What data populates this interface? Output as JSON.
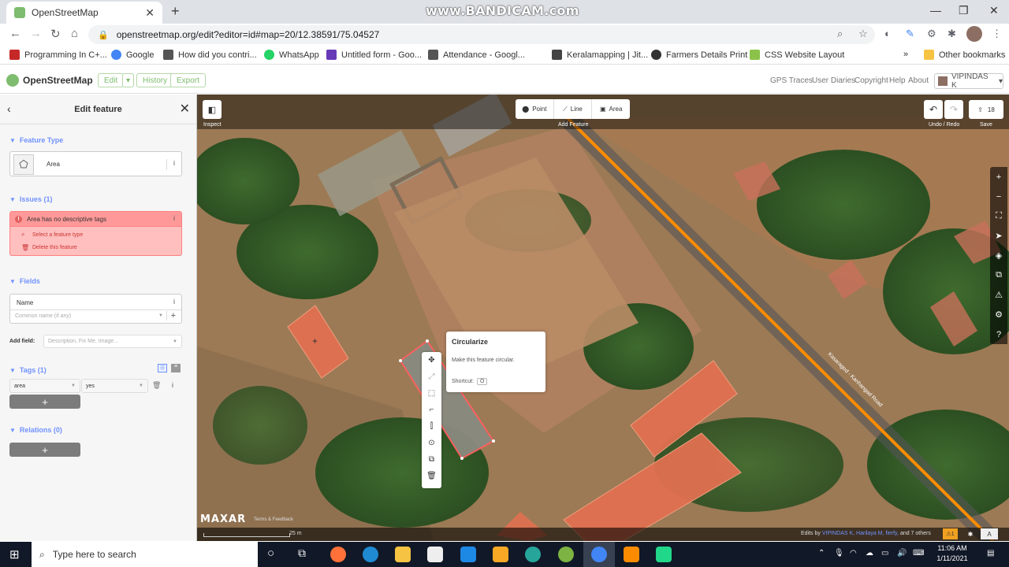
{
  "browser": {
    "tab_title": "OpenStreetMap",
    "watermark": "www.BANDICAM.com",
    "url": "openstreetmap.org/edit?editor=id#map=20/12.38591/75.04527",
    "bookmarks": [
      "Programming In C+...",
      "Google",
      "How did you contri...",
      "WhatsApp",
      "Untitled form - Goo...",
      "Attendance - Googl...",
      "Keralamapping | Jit...",
      "Farmers Details Print",
      "CSS Website Layout"
    ],
    "other_bookmarks": "Other bookmarks"
  },
  "osm": {
    "logo": "OpenStreetMap",
    "edit": "Edit",
    "history": "History",
    "export": "Export",
    "nav": [
      "GPS Traces",
      "User Diaries",
      "Copyright",
      "Help",
      "About"
    ],
    "user": "VIPINDAS K"
  },
  "sidebar": {
    "title": "Edit feature",
    "feature_type_label": "Feature Type",
    "feature_type": "Area",
    "issues_label": "Issues (1)",
    "issue": "Area has no descriptive tags",
    "issue_action_1": "Select a feature type",
    "issue_action_2": "Delete this feature",
    "fields_label": "Fields",
    "name_label": "Name",
    "name_placeholder": "Common name (if any)",
    "add_field_label": "Add field:",
    "add_field_placeholder": "Description, Fix Me, Image...",
    "tags_label": "Tags (1)",
    "tag_key": "area",
    "tag_value": "yes",
    "relations_label": "Relations (0)"
  },
  "map": {
    "inspect": "Inspect",
    "modes": [
      "Point",
      "Line",
      "Area"
    ],
    "add_feature": "Add Feature",
    "undo_redo": "Undo / Redo",
    "save": "Save",
    "save_count": "18",
    "road_name": "Kasaragod - Kanhangad Road",
    "tooltip_title": "Circularize",
    "tooltip_desc": "Make this feature circular.",
    "tooltip_shortcut_label": "Shortcut:",
    "tooltip_shortcut_key": "O",
    "maxar": "MAXAR",
    "terms": "Terms & Feedback",
    "scale": "25 m",
    "edits_prefix": "Edits by",
    "edits_names": "VIPINDAS K, Harilaya M, fierfy,",
    "edits_suffix": "and 7 others",
    "issues_count": "1"
  },
  "taskbar": {
    "search_placeholder": "Type here to search",
    "time": "11:06 AM",
    "date": "1/11/2021"
  },
  "colors": {
    "osm_green": "#7ebc6f",
    "issue_red": "#ff9999",
    "road_orange": "#ff8c00",
    "building": "#e07050",
    "link_blue": "#7092ff"
  }
}
